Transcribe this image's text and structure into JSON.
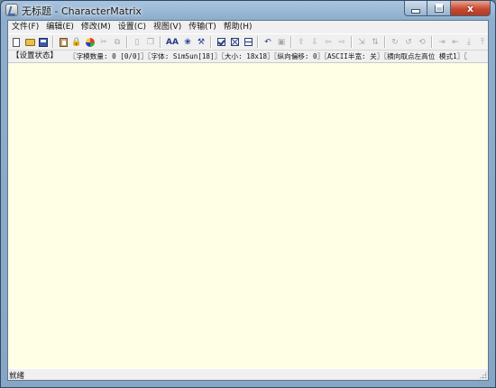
{
  "window": {
    "title": "无标题 - CharacterMatrix",
    "close_glyph": "x"
  },
  "menu": [
    {
      "label": "文件(F)"
    },
    {
      "label": "编辑(E)"
    },
    {
      "label": "修改(M)"
    },
    {
      "label": "设置(C)"
    },
    {
      "label": "视图(V)"
    },
    {
      "label": "传输(T)"
    },
    {
      "label": "帮助(H)"
    }
  ],
  "toolbar": {
    "font_label": "AA",
    "icons": [
      "new-file-icon",
      "open-folder-icon",
      "save-icon",
      "paste-icon",
      "lock-icon",
      "palette-icon",
      "cut-icon",
      "copy-icon",
      "page-icon",
      "pages-icon",
      "font-icon",
      "paw-icon",
      "tools-icon",
      "check-box-icon",
      "cross-box-icon",
      "half-box-icon",
      "rotate-page-icon",
      "frame-icon",
      "arrow-up-icon",
      "arrow-down-icon",
      "arrow-left-icon",
      "arrow-right-icon",
      "align-icon",
      "sort-icon",
      "rotate-cw-icon",
      "rotate-ccw-icon",
      "undo-icon",
      "width-expand-icon",
      "width-shrink-icon",
      "height-shrink-icon",
      "height-expand-icon"
    ]
  },
  "state_bar": {
    "label": "【设置状态】",
    "values": "〖字模数量: 0 [0/0]〗〖字体: SimSun[18]〗〖大小: 18x18〗〖纵向偏移: 0〗〖ASCII半宽: 关〗〖横向取点左高位 模式1〗〖"
  },
  "status_bar": {
    "text": "就绪"
  },
  "colors": {
    "canvas_background": "#ffffe6",
    "chrome_background": "#f0f0f0",
    "close_button": "#c94a30",
    "frame": "#8eaecc"
  }
}
